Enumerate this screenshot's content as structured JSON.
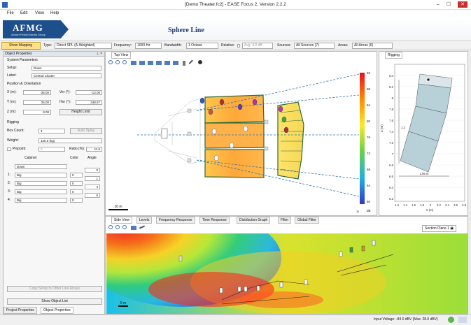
{
  "window": {
    "title": "[Demo Theater.fc2] - EASE Focus 2, Version 2.2.2",
    "minimize": "–",
    "maximize": "☐",
    "close": "✕"
  },
  "menu": [
    "File",
    "Edit",
    "View",
    "Help"
  ],
  "banner": {
    "logo": "AFMG",
    "logo_sub": "Ahnert Feistel Media Group",
    "title": "Sphere Line"
  },
  "toolbar": {
    "show_mapping": "Show Mapping",
    "type_label": "Type:",
    "type_value": "Direct SPL (A-Weighted)",
    "frequency_label": "Frequency:",
    "frequency_value": "1000 Hz",
    "bandwidth_label": "Bandwidth:",
    "bandwidth_value": "1 Octave",
    "relative_label": "Relative:",
    "relative_value": "Avg. 4.0 dB",
    "sources_label": "Sources:",
    "sources_value": "All Sources (7)",
    "areas_label": "Areas:",
    "areas_value": "All Areas (6)"
  },
  "object_properties": {
    "title": "Object Properties",
    "pin": "⊥ ×",
    "system_parameters": "System Parameters",
    "setup_label": "Setup:",
    "setup_value": "Down",
    "label_label": "Label:",
    "label_value": "Central Cluster",
    "position_heading": "Position & Orientation",
    "x_label": "X (m):",
    "x_value": "-35.00",
    "y_label": "Y (m):",
    "y_value": "25.00",
    "z_label": "Z (m):",
    "z_value": "8.00",
    "ver_label": "Ver (°):",
    "ver_value": "-13.00",
    "hor_label": "Hor (°):",
    "hor_value": "348.57",
    "height_limit": "Height Limit",
    "rigging_heading": "Rigging",
    "boxcount_label": "Box Count:",
    "boxcount_value": "4",
    "auto_splay": "Auto Splay",
    "weight_label": "Weight:",
    "weight_value": "120.0 (kg)",
    "pinpoint_label": "Pinpoint:",
    "pinpoint_value": "0",
    "ratio_label": "Ratio (%):",
    "ratio_value": "41.6",
    "col_cabinet": "Cabinet",
    "col_color": "Color",
    "col_angle": "Angle",
    "cabinets": [
      {
        "idx": "",
        "name": "Down",
        "color": "",
        "angle": "0"
      },
      {
        "idx": "1:",
        "name": "Big",
        "color": "0",
        "angle": "1"
      },
      {
        "idx": "2:",
        "name": "Big",
        "color": "0",
        "angle": "4"
      },
      {
        "idx": "3:",
        "name": "Big",
        "color": "0",
        "angle": "6"
      },
      {
        "idx": "4:",
        "name": "Big",
        "color": "0",
        "angle": ""
      }
    ],
    "copy_setup": "Copy Setup to Other Line Arrays",
    "show_object_list": "Show Object List",
    "tab_project": "Project Properties",
    "tab_object": "Object Properties"
  },
  "top_view": {
    "tab": "Top View",
    "scale": "10 m",
    "scale_values": [
      "92",
      "88",
      "84",
      "80",
      "76",
      "72",
      "68",
      "64",
      "60"
    ],
    "unit": "dB",
    "corner": "⇲"
  },
  "rigging_panel": {
    "tab": "Rigging",
    "y_ticks": [
      "8.4",
      "8.2",
      "8",
      "7.8",
      "7.6",
      "7.4",
      "7.2",
      "7",
      "6.8",
      "6.6",
      "6.4",
      "6.2"
    ],
    "x_ticks": [
      "1.2",
      "1.4",
      "1.6",
      "1.8",
      "2",
      "2.2",
      "2.4",
      "2.6",
      "2.8"
    ],
    "x_axis": "X (m)",
    "y_axis": "Z (m)",
    "width_dim": "1.05 m",
    "height_dim": "1.2"
  },
  "side_view": {
    "tabs": [
      "Side View",
      "Levels",
      "Frequency Response",
      "Time Response",
      "Distribution Graph",
      "Filter",
      "Global Filter"
    ],
    "section_plane": "Section Plane 1",
    "scale": "5 m"
  },
  "status": {
    "input_voltage": "Input Voltage: -84.0 dBV (Max: 28.0 dBV)"
  }
}
